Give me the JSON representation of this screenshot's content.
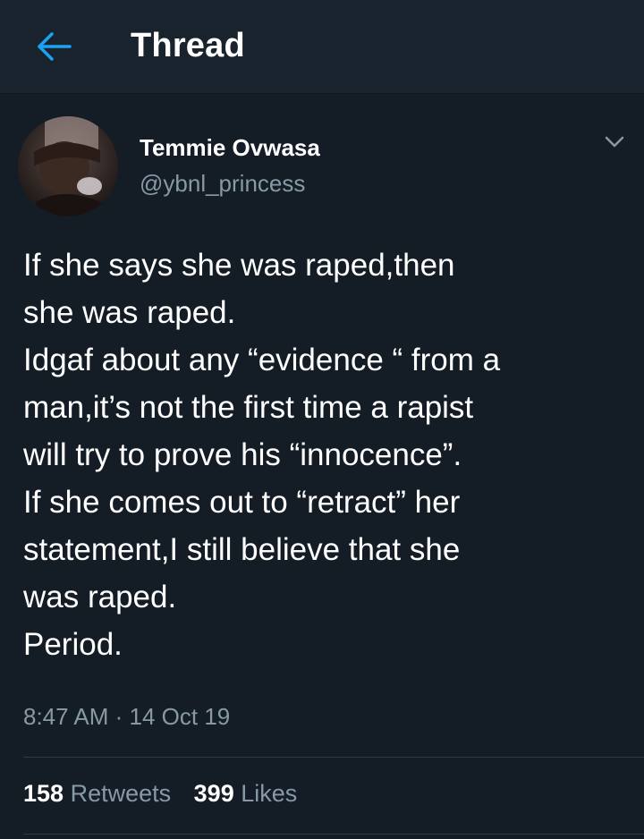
{
  "header": {
    "title": "Thread",
    "back_icon": "arrow-left-icon",
    "accent_color": "#1da1f2"
  },
  "tweet": {
    "author": {
      "name": "Temmie Ovwasa",
      "handle": "@ybnl_princess"
    },
    "menu_icon": "chevron-down-icon",
    "lines": [
      "If she says she was raped,then",
      "she was raped.",
      "Idgaf about any “evidence “ from a",
      "man,it’s not the first time a rapist",
      "will try to prove his “innocence”.",
      "If she comes out to “retract” her",
      "statement,I still believe that she",
      "was raped.",
      "Period."
    ],
    "timestamp": "8:47 AM · 14 Oct 19",
    "stats": {
      "retweets_count": "158",
      "retweets_label": "Retweets",
      "likes_count": "399",
      "likes_label": "Likes"
    }
  },
  "colors": {
    "background": "#141d26",
    "header_background": "#19232d",
    "secondary_text": "#8899a6",
    "divider": "#2c3a47"
  }
}
